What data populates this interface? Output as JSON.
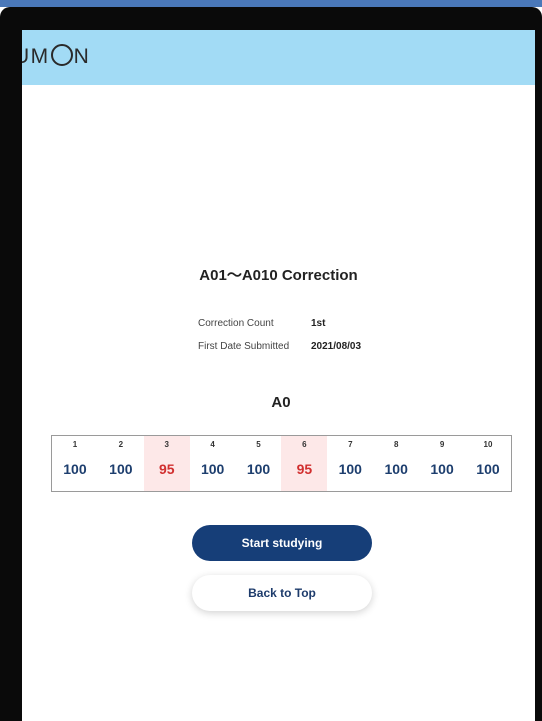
{
  "header": {
    "logo_text_pre": "UM",
    "logo_text_post": "N"
  },
  "title": "A01～A010 Correction",
  "info": {
    "count_label": "Correction Count",
    "count_value": "1st",
    "date_label": "First Date Submitted",
    "date_value": "2021/08/03"
  },
  "section_label": "A0",
  "scores": [
    {
      "n": "1",
      "score": "100",
      "highlight": false
    },
    {
      "n": "2",
      "score": "100",
      "highlight": false
    },
    {
      "n": "3",
      "score": "95",
      "highlight": true
    },
    {
      "n": "4",
      "score": "100",
      "highlight": false
    },
    {
      "n": "5",
      "score": "100",
      "highlight": false
    },
    {
      "n": "6",
      "score": "95",
      "highlight": true
    },
    {
      "n": "7",
      "score": "100",
      "highlight": false
    },
    {
      "n": "8",
      "score": "100",
      "highlight": false
    },
    {
      "n": "9",
      "score": "100",
      "highlight": false
    },
    {
      "n": "10",
      "score": "100",
      "highlight": false
    }
  ],
  "buttons": {
    "start": "Start studying",
    "back": "Back to Top"
  },
  "colors": {
    "header": "#a2dbf5",
    "primary": "#163e78",
    "score": "#1d3e6e",
    "error": "#d12f2f",
    "error_bg": "#fde8e8"
  }
}
